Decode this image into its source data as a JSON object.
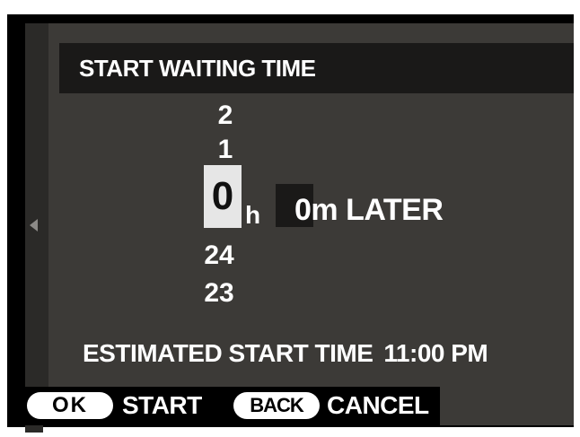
{
  "title": "START WAITING TIME",
  "hours": {
    "above": [
      "2",
      "1"
    ],
    "selected": "0",
    "unit": "h",
    "below": [
      "24",
      "23"
    ]
  },
  "minutes": {
    "value": "0m",
    "suffix": "LATER"
  },
  "estimate": {
    "label": "ESTIMATED START TIME",
    "time": "11:00 PM"
  },
  "footer": {
    "ok_key": "OK",
    "ok_label": "START",
    "back_key": "BACK",
    "back_label": "CANCEL"
  },
  "icons": {
    "left": "left-arrow-icon"
  },
  "colors": {
    "screen_bg": "#3c3a37",
    "bar_bg": "#1a1918",
    "highlight": "#e6e6e6",
    "text": "#ffffff"
  }
}
